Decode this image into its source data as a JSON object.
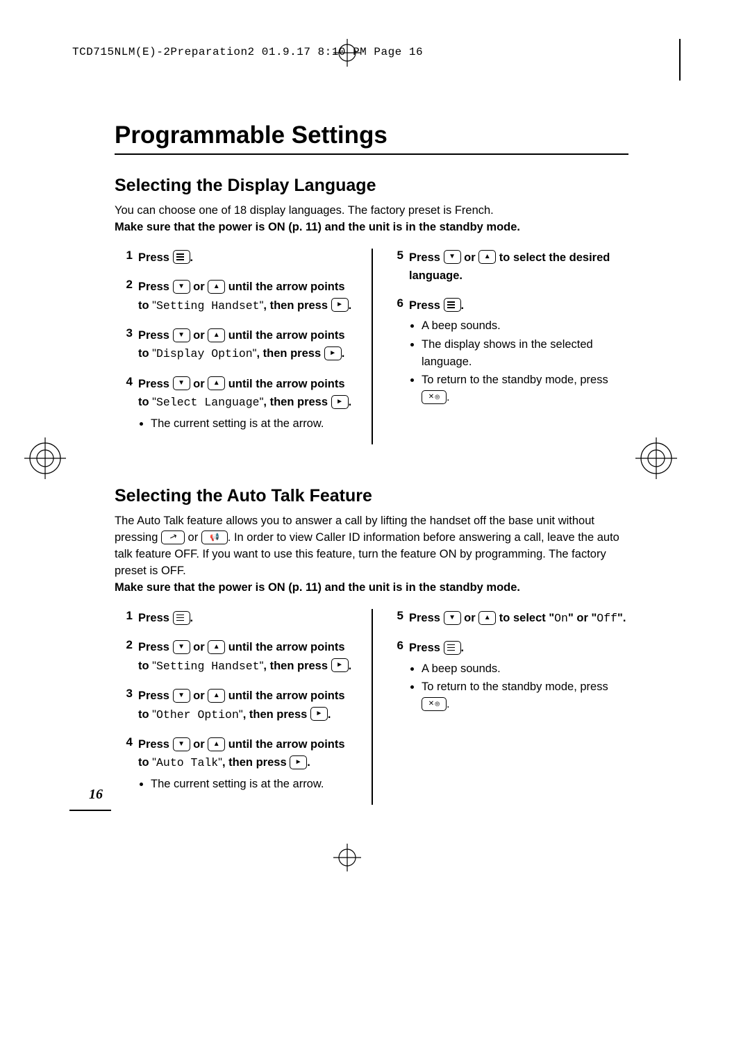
{
  "header_line": "TCD715NLM(E)-2Preparation2  01.9.17 8:10 PM  Page 16",
  "page_number": "16",
  "title": "Programmable Settings",
  "section1": {
    "heading": "Selecting the Display Language",
    "intro_line1": "You can choose one of 18 display languages. The factory preset is French.",
    "standby_note": "Make sure that the power is ON (p. 11) and the unit is in the standby mode.",
    "steps_left": [
      {
        "num": "1",
        "prefix": "Press ",
        "after": "."
      },
      {
        "num": "2",
        "prefix": "Press ",
        "mid": " or ",
        "tail": " until the arrow points to ",
        "option": "Setting Handset",
        "thenpress": ", then press ",
        "end": "."
      },
      {
        "num": "3",
        "prefix": "Press ",
        "mid": " or ",
        "tail": " until the arrow points to ",
        "option": "Display Option",
        "thenpress": ", then press ",
        "end": "."
      },
      {
        "num": "4",
        "prefix": "Press ",
        "mid": " or ",
        "tail": " until the arrow points to ",
        "option": "Select Language",
        "thenpress": ", then press ",
        "end": ".",
        "bullet": "The current setting is at the arrow."
      }
    ],
    "steps_right": [
      {
        "num": "5",
        "prefix": "Press ",
        "mid": " or ",
        "tail": " to select the desired language."
      },
      {
        "num": "6",
        "prefix": "Press ",
        "after": ".",
        "bullets": [
          "A beep sounds.",
          "The display shows in the selected language.",
          "To return to the standby mode, press "
        ]
      }
    ]
  },
  "section2": {
    "heading": "Selecting the Auto Talk Feature",
    "intro_pre": "The Auto Talk feature allows you to answer a call by lifting the handset off the base unit without pressing ",
    "intro_mid_or": " or ",
    "intro_post": ". In order to view Caller ID information before answering a call, leave the auto talk feature OFF. If you want to use this feature, turn the feature ON by programming. The factory preset is OFF.",
    "standby_note": "Make sure that the power is ON (p. 11) and the unit is in the standby mode.",
    "steps_left": [
      {
        "num": "1",
        "prefix": "Press ",
        "after": "."
      },
      {
        "num": "2",
        "prefix": "Press ",
        "mid": " or ",
        "tail": " until the arrow points to ",
        "option": "Setting Handset",
        "thenpress": ", then press ",
        "end": "."
      },
      {
        "num": "3",
        "prefix": "Press ",
        "mid": " or ",
        "tail": " until the arrow points to ",
        "option": "Other Option",
        "thenpress": ", then press ",
        "end": "."
      },
      {
        "num": "4",
        "prefix": "Press ",
        "mid": " or ",
        "tail": " until the arrow points to ",
        "option": "Auto Talk",
        "thenpress": ", then press ",
        "end": ".",
        "bullet": "The current setting is at the arrow."
      }
    ],
    "steps_right": [
      {
        "num": "5",
        "prefix": "Press ",
        "mid": " or ",
        "tail_pre": " to select \"",
        "opt1": "On",
        "tail_mid": "\" or \"",
        "opt2": "Off",
        "tail_post": "\"."
      },
      {
        "num": "6",
        "prefix": "Press ",
        "after": ".",
        "bullets": [
          "A beep sounds.",
          "To return to the standby mode, press "
        ]
      }
    ]
  }
}
